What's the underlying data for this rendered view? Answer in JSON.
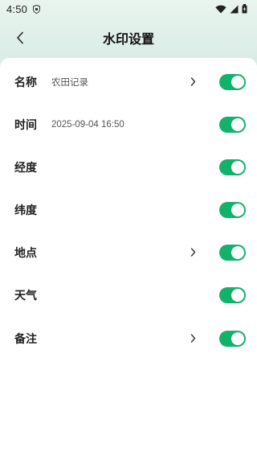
{
  "status_bar": {
    "time": "4:50",
    "icons": [
      "shield-icon",
      "wifi-icon",
      "signal-icon",
      "battery-icon"
    ]
  },
  "header": {
    "title": "水印设置",
    "back_icon": "back-arrow-icon"
  },
  "colors": {
    "accent": "#12b26b",
    "background": "#e6f1ec",
    "card": "#ffffff"
  },
  "settings": [
    {
      "label": "名称",
      "value": "农田记录",
      "has_chevron": true,
      "enabled": true
    },
    {
      "label": "时间",
      "value": "2025-09-04 16:50",
      "has_chevron": false,
      "enabled": true
    },
    {
      "label": "经度",
      "value": "",
      "has_chevron": false,
      "enabled": true
    },
    {
      "label": "纬度",
      "value": "",
      "has_chevron": false,
      "enabled": true
    },
    {
      "label": "地点",
      "value": "",
      "has_chevron": true,
      "enabled": true
    },
    {
      "label": "天气",
      "value": "",
      "has_chevron": false,
      "enabled": true
    },
    {
      "label": "备注",
      "value": "",
      "has_chevron": true,
      "enabled": true
    }
  ]
}
